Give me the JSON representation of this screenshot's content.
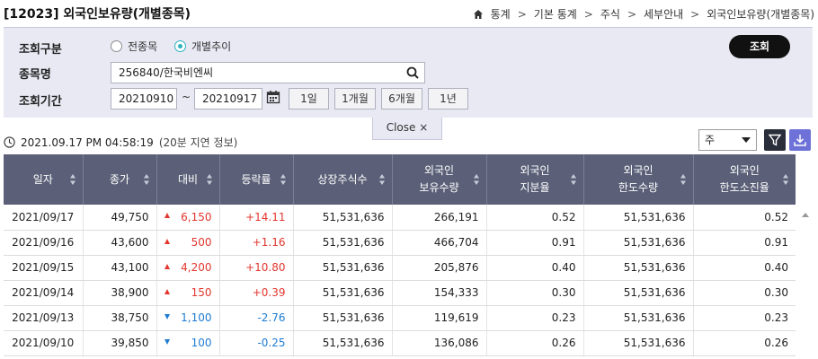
{
  "header": {
    "title": "[12023] 외국인보유량(개별종목)",
    "breadcrumbs": [
      "통계",
      "기본 통계",
      "주식",
      "세부안내",
      "외국인보유량(개별종목)"
    ]
  },
  "search": {
    "type_label": "조회구분",
    "type_options": [
      {
        "label": "전종목",
        "selected": false
      },
      {
        "label": "개별추이",
        "selected": true
      }
    ],
    "stock_label": "종목명",
    "stock_value": "256840/한국비엔씨",
    "period_label": "조회기간",
    "start_date": "20210910",
    "end_date": "20210917",
    "tilde": "~",
    "quick_periods": [
      "1일",
      "1개월",
      "6개월",
      "1년"
    ],
    "submit_label": "조회",
    "close_label": "Close ×"
  },
  "status": {
    "timestamp": "2021.09.17 PM 04:58:19",
    "delay_note": "(20분 지연 정보)"
  },
  "toolbar": {
    "period_select": "주"
  },
  "colors": {
    "up": "#e2362e",
    "down": "#1d7bd3",
    "header_bg": "#5b6078",
    "panel_bg": "#e8e9f3",
    "download_btn": "#6e72d8"
  },
  "table": {
    "columns": [
      "일자",
      "종가",
      "대비",
      "등락률",
      "상장주식수",
      "외국인 보유수량",
      "외국인 지분율",
      "외국인 한도수량",
      "외국인 한도소진율"
    ],
    "columns_lines": [
      [
        "일자"
      ],
      [
        "종가"
      ],
      [
        "대비"
      ],
      [
        "등락률"
      ],
      [
        "상장주식수"
      ],
      [
        "외국인",
        "보유수량"
      ],
      [
        "외국인",
        "지분율"
      ],
      [
        "외국인",
        "한도수량"
      ],
      [
        "외국인",
        "한도소진율"
      ]
    ],
    "rows": [
      {
        "date": "2021/09/17",
        "close": "49,750",
        "direction": "up",
        "change": "6,150",
        "rate": "+14.11",
        "listed": "51,531,636",
        "foreign_qty": "266,191",
        "foreign_ratio": "0.52",
        "limit_qty": "51,531,636",
        "limit_rate": "0.52"
      },
      {
        "date": "2021/09/16",
        "close": "43,600",
        "direction": "up",
        "change": "500",
        "rate": "+1.16",
        "listed": "51,531,636",
        "foreign_qty": "466,704",
        "foreign_ratio": "0.91",
        "limit_qty": "51,531,636",
        "limit_rate": "0.91"
      },
      {
        "date": "2021/09/15",
        "close": "43,100",
        "direction": "up",
        "change": "4,200",
        "rate": "+10.80",
        "listed": "51,531,636",
        "foreign_qty": "205,876",
        "foreign_ratio": "0.40",
        "limit_qty": "51,531,636",
        "limit_rate": "0.40"
      },
      {
        "date": "2021/09/14",
        "close": "38,900",
        "direction": "up",
        "change": "150",
        "rate": "+0.39",
        "listed": "51,531,636",
        "foreign_qty": "154,333",
        "foreign_ratio": "0.30",
        "limit_qty": "51,531,636",
        "limit_rate": "0.30"
      },
      {
        "date": "2021/09/13",
        "close": "38,750",
        "direction": "down",
        "change": "1,100",
        "rate": "-2.76",
        "listed": "51,531,636",
        "foreign_qty": "119,619",
        "foreign_ratio": "0.23",
        "limit_qty": "51,531,636",
        "limit_rate": "0.23"
      },
      {
        "date": "2021/09/10",
        "close": "39,850",
        "direction": "down",
        "change": "100",
        "rate": "-0.25",
        "listed": "51,531,636",
        "foreign_qty": "136,086",
        "foreign_ratio": "0.26",
        "limit_qty": "51,531,636",
        "limit_rate": "0.26"
      }
    ]
  }
}
